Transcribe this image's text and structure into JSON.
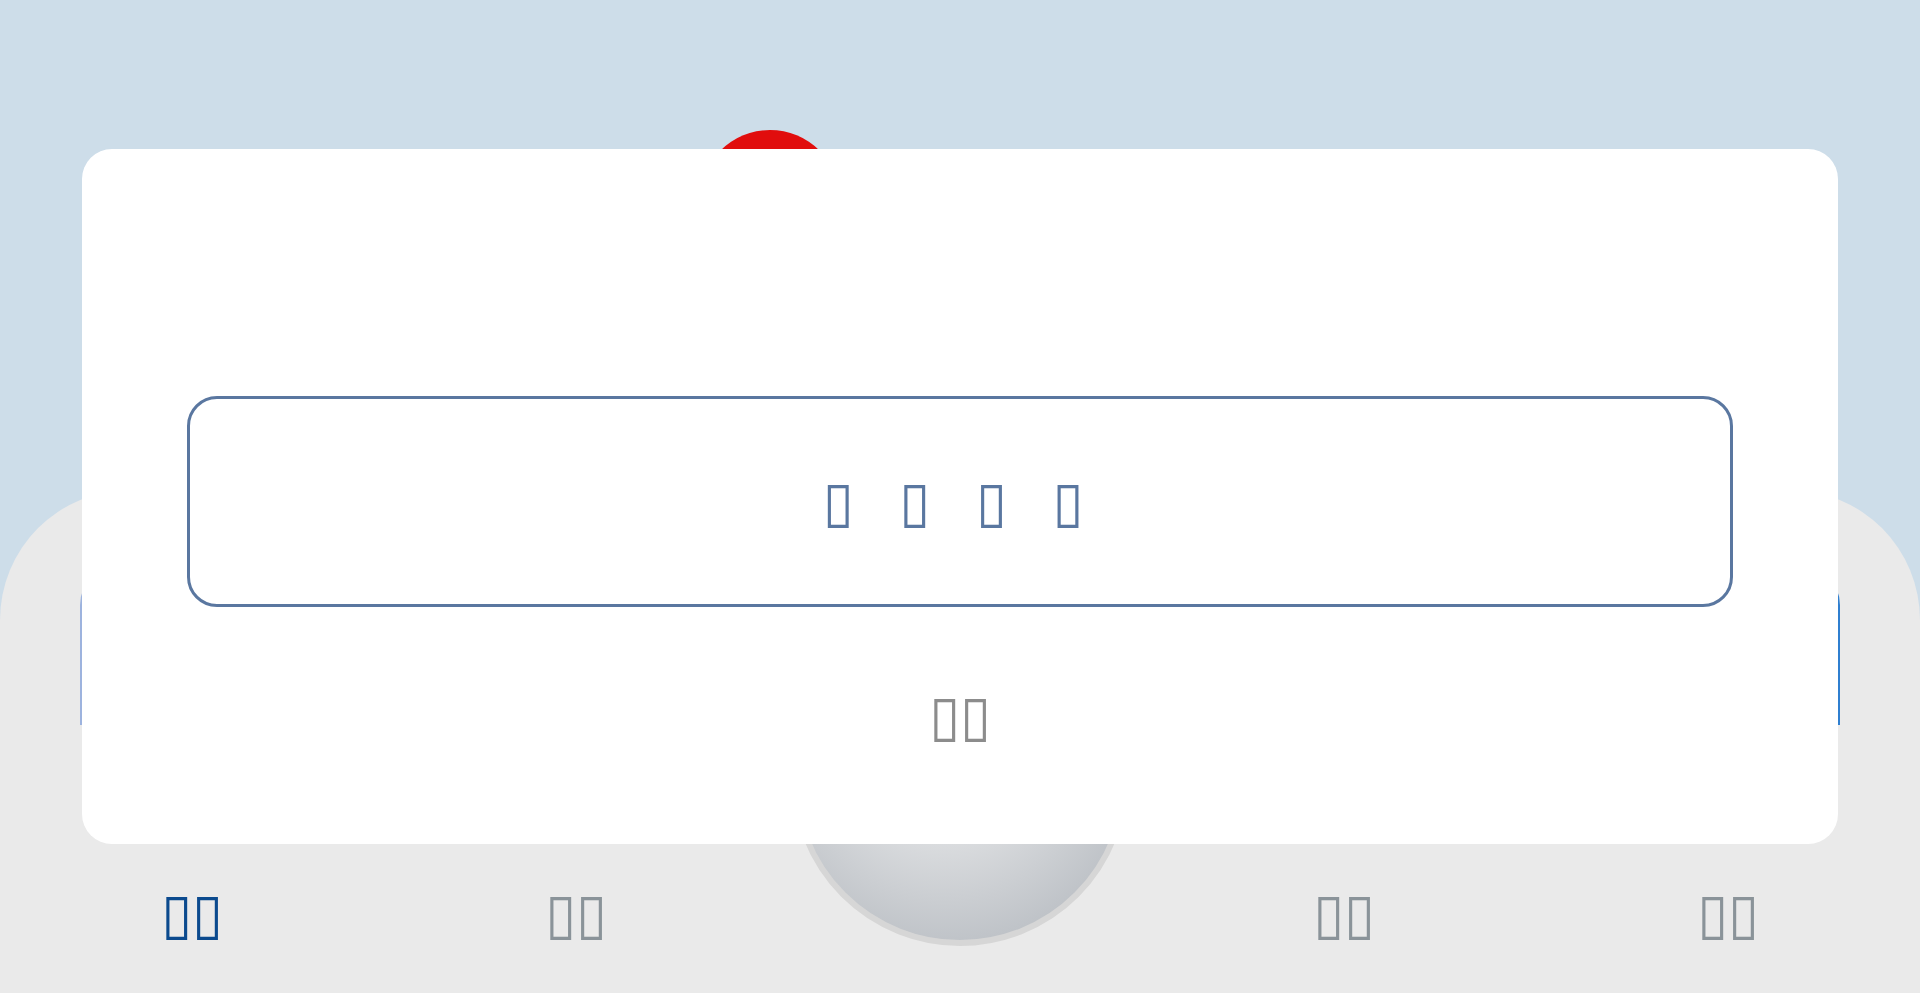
{
  "dialog": {
    "primary_button": "▯ ▯ ▯ ▯",
    "cancel": "▯▯"
  },
  "tab_bar": {
    "items": [
      {
        "label": "▯▯",
        "kind": "tab",
        "selected": true
      },
      {
        "label": "▯▯",
        "kind": "tab",
        "selected": false
      },
      {
        "kind": "center"
      },
      {
        "label": "▯▯",
        "kind": "tab",
        "selected": false
      },
      {
        "label": "▯▯",
        "kind": "tab",
        "selected": false
      }
    ]
  }
}
